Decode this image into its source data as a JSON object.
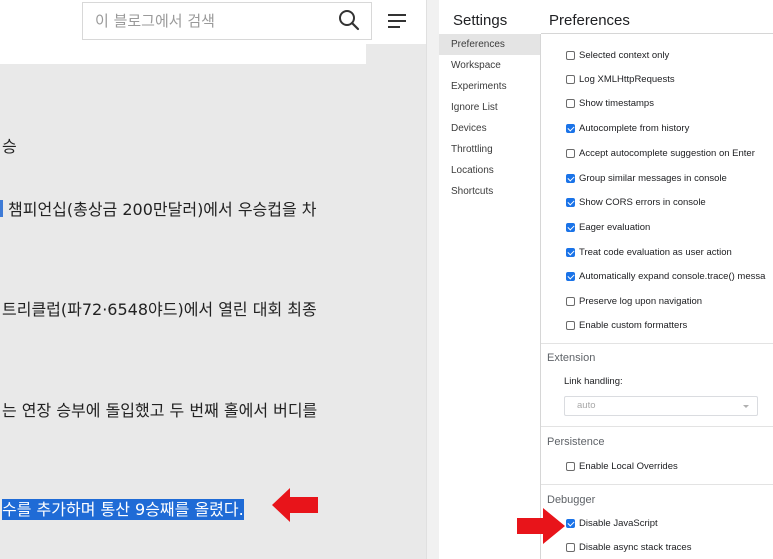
{
  "blog": {
    "search_placeholder": "이 블로그에서 검색",
    "lines": [
      "승",
      "챔피언십(총상금 200만달러)에서 우승컵을 차",
      "트리클럽(파72·6548야드)에서 열린 대회 최종",
      "는 연장 승부에 돌입했고 두 번째 홀에서 버디를",
      "수를 추",
      "가하며 통산 9승째를 올렸다."
    ]
  },
  "devtools": {
    "settings_title": "Settings",
    "nav": [
      "Preferences",
      "Workspace",
      "Experiments",
      "Ignore List",
      "Devices",
      "Throttling",
      "Locations",
      "Shortcuts"
    ],
    "panel_title": "Preferences",
    "options": [
      {
        "label": "Selected context only",
        "checked": false
      },
      {
        "label": "Log XMLHttpRequests",
        "checked": false
      },
      {
        "label": "Show timestamps",
        "checked": false
      },
      {
        "label": "Autocomplete from history",
        "checked": true
      },
      {
        "label": "Accept autocomplete suggestion on Enter",
        "checked": false
      },
      {
        "label": "Group similar messages in console",
        "checked": true
      },
      {
        "label": "Show CORS errors in console",
        "checked": true
      },
      {
        "label": "Eager evaluation",
        "checked": true
      },
      {
        "label": "Treat code evaluation as user action",
        "checked": true
      },
      {
        "label": "Automatically expand console.trace() messa",
        "checked": true
      },
      {
        "label": "Preserve log upon navigation",
        "checked": false
      },
      {
        "label": "Enable custom formatters",
        "checked": false
      }
    ],
    "extension": {
      "title": "Extension",
      "link_handling_label": "Link handling:",
      "link_handling_value": "auto"
    },
    "persistence": {
      "title": "Persistence",
      "options": [
        {
          "label": "Enable Local Overrides",
          "checked": false
        }
      ]
    },
    "debugger": {
      "title": "Debugger",
      "options": [
        {
          "label": "Disable JavaScript",
          "checked": true
        },
        {
          "label": "Disable async stack traces",
          "checked": false
        }
      ]
    }
  },
  "colors": {
    "highlight": "#1f6bd6",
    "accent": "#1a73e8",
    "arrow": "#e8141a"
  }
}
